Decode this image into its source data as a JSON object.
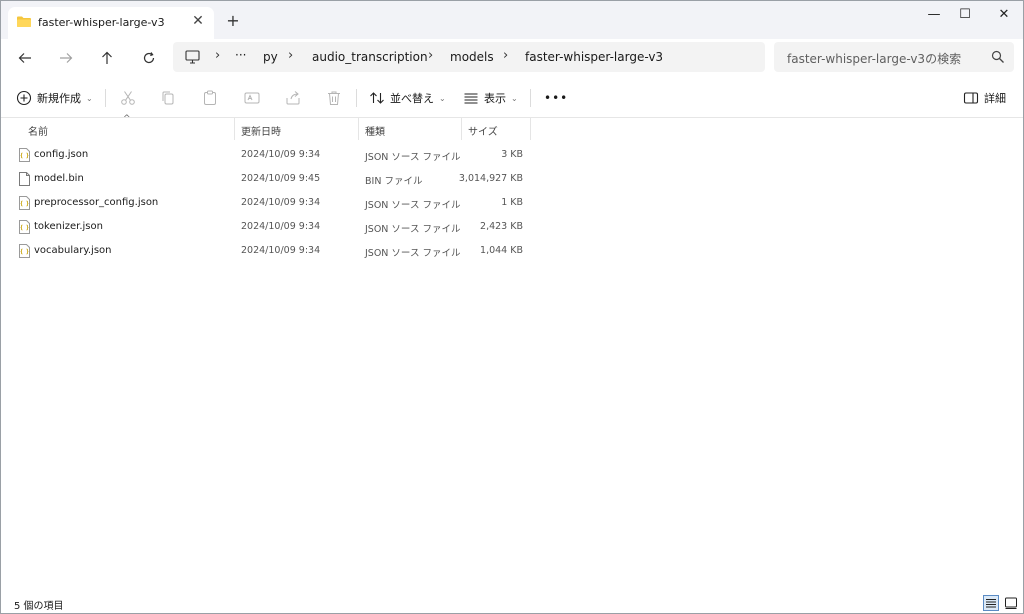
{
  "tab": {
    "title": "faster-whisper-large-v3",
    "close": "✕",
    "new_tab": "+"
  },
  "window_controls": {
    "minimize": "—",
    "maximize": "☐",
    "close": "✕"
  },
  "nav": {
    "more": "···",
    "breadcrumb": [
      "py",
      "audio_transcription",
      "models",
      "faster-whisper-large-v3"
    ],
    "search_placeholder": "faster-whisper-large-v3の検索"
  },
  "commands": {
    "new": "新規作成",
    "sort": "並べ替え",
    "view": "表示",
    "more": "•••",
    "details": "詳細"
  },
  "columns": {
    "name": "名前",
    "date": "更新日時",
    "type": "種類",
    "size": "サイズ"
  },
  "files": [
    {
      "name": "config.json",
      "date": "2024/10/09 9:34",
      "type": "JSON ソース ファイル",
      "size": "3 KB",
      "icon": "json-file-icon"
    },
    {
      "name": "model.bin",
      "date": "2024/10/09 9:45",
      "type": "BIN ファイル",
      "size": "3,014,927 KB",
      "icon": "bin-file-icon"
    },
    {
      "name": "preprocessor_config.json",
      "date": "2024/10/09 9:34",
      "type": "JSON ソース ファイル",
      "size": "1 KB",
      "icon": "json-file-icon"
    },
    {
      "name": "tokenizer.json",
      "date": "2024/10/09 9:34",
      "type": "JSON ソース ファイル",
      "size": "2,423 KB",
      "icon": "json-file-icon"
    },
    {
      "name": "vocabulary.json",
      "date": "2024/10/09 9:34",
      "type": "JSON ソース ファイル",
      "size": "1,044 KB",
      "icon": "json-file-icon"
    }
  ],
  "status": {
    "item_count": "5 個の項目"
  },
  "colors": {
    "folder": "#f4c63d",
    "accent": "#005fb8",
    "titlebar_bg": "#f2f3f7"
  }
}
